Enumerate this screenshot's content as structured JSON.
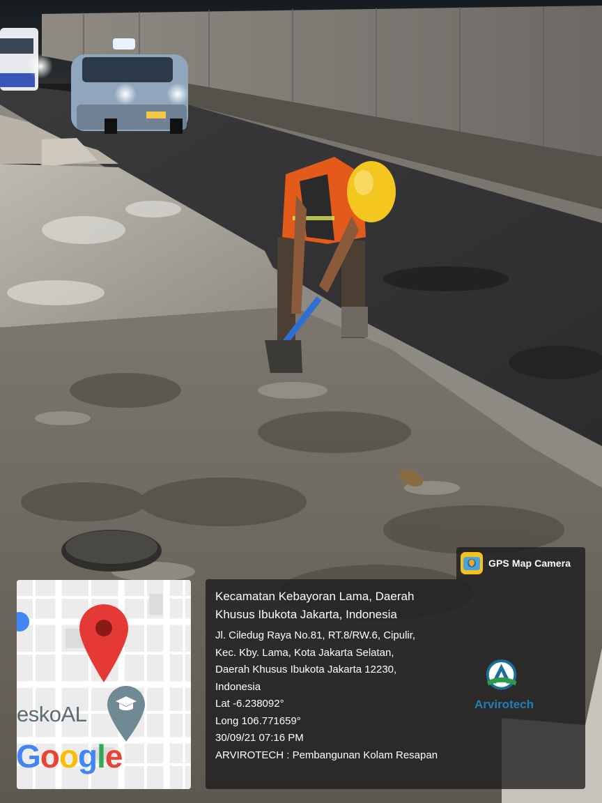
{
  "photo": {
    "subject": "construction-worker-mixing-concrete"
  },
  "map": {
    "place_label": "eskoAL",
    "provider_word": "Google",
    "provider_colors": [
      "#4285F4",
      "#EA4335",
      "#FBBC05",
      "#4285F4",
      "#34A853",
      "#EA4335"
    ],
    "pin_color": "#E53935",
    "place_icon": "graduation-cap-icon"
  },
  "gps": {
    "app_name": "GPS Map Camera",
    "app_icon": "camera-pin-icon"
  },
  "location": {
    "title": "Kecamatan Kebayoran Lama, Daerah Khusus Ibukota Jakarta, Indonesia",
    "address_lines": [
      "Jl. Ciledug Raya No.81, RT.8/RW.6, Cipulir,",
      "Kec. Kby. Lama, Kota Jakarta Selatan,",
      "Daerah Khusus Ibukota Jakarta 12230,",
      "Indonesia"
    ],
    "lat": "Lat -6.238092°",
    "long": "Long 106.771659°",
    "datetime": "30/09/21 07:16 PM",
    "note": "ARVIROTECH : Pembangunan Kolam Resapan"
  },
  "company": {
    "logo_name": "arvirotech-logo",
    "name": "Arvirotech",
    "color": "#1f7fb8"
  }
}
